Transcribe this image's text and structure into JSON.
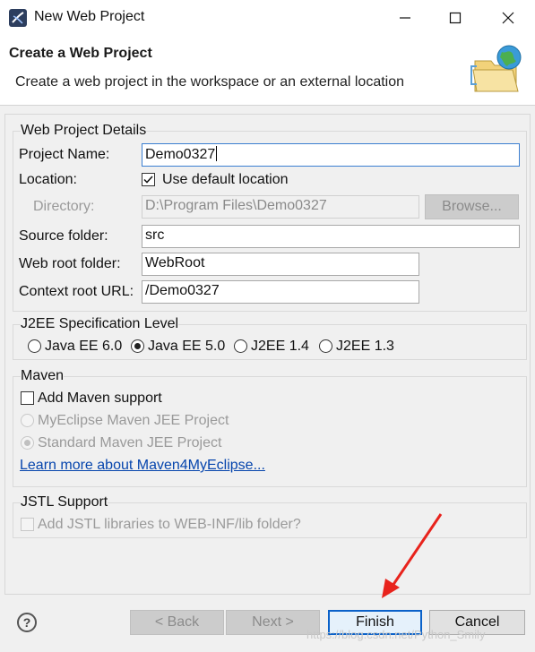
{
  "window": {
    "title": "New Web Project"
  },
  "header": {
    "title": "Create a Web Project",
    "description": "Create a web project in the workspace or an external location"
  },
  "details": {
    "group_title": "Web Project Details",
    "project_name_label": "Project Name:",
    "project_name_value": "Demo0327",
    "location_label": "Location:",
    "use_default_label": "Use default location",
    "use_default_checked": true,
    "directory_label": "Directory:",
    "directory_value": "D:\\Program Files\\Demo0327",
    "browse_label": "Browse...",
    "source_folder_label": "Source folder:",
    "source_folder_value": "src",
    "web_root_label": "Web root folder:",
    "web_root_value": "WebRoot",
    "context_root_label": "Context root URL:",
    "context_root_value": "/Demo0327"
  },
  "j2ee": {
    "group_title": "J2EE Specification Level",
    "options": [
      "Java EE 6.0",
      "Java EE 5.0",
      "J2EE 1.4",
      "J2EE 1.3"
    ],
    "selected": "Java EE 5.0"
  },
  "maven": {
    "group_title": "Maven",
    "add_support_label": "Add Maven support",
    "myeclipse_label": "MyEclipse Maven JEE Project",
    "standard_label": "Standard Maven JEE Project",
    "learn_more_label": "Learn more about Maven4MyEclipse..."
  },
  "jstl": {
    "group_title": "JSTL Support",
    "add_jstl_label": "Add JSTL libraries to WEB-INF/lib folder?"
  },
  "footer": {
    "back_label": "< Back",
    "next_label": "Next >",
    "finish_label": "Finish",
    "cancel_label": "Cancel",
    "watermark": "https://blog.csdn.net/Python_Smily"
  },
  "colors": {
    "accent": "#0a61c9",
    "arrow": "#e8231c",
    "link": "#0645ad"
  }
}
